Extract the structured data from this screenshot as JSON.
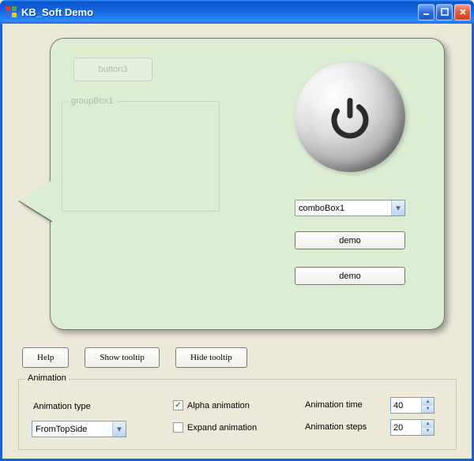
{
  "window": {
    "title": "KB_Soft Demo"
  },
  "bubble": {
    "ghost_button_label": "button3",
    "ghost_groupbox_label": "groupBox1",
    "combo_value": "comboBox1",
    "demo_btn1_label": "demo",
    "demo_btn2_label": "demo"
  },
  "buttons": {
    "help": "Help",
    "show_tooltip": "Show tooltip",
    "hide_tooltip": "Hide tooltip"
  },
  "animation": {
    "group_label": "Animation",
    "type_label": "Animation type",
    "type_value": "FromTopSide",
    "alpha_label": "Alpha animation",
    "alpha_checked": "✓",
    "expand_label": "Expand animation",
    "time_label": "Animation time",
    "time_value": "40",
    "steps_label": "Animation steps",
    "steps_value": "20"
  }
}
